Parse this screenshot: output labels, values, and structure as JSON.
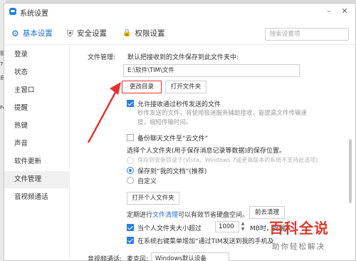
{
  "window": {
    "title": "系统设置",
    "controls": {
      "minimize_icon": "–",
      "close_icon": "✕"
    }
  },
  "navbar": {
    "tabs": [
      {
        "label": "基本设置",
        "icon": "gear-icon",
        "glyph": "⚙"
      },
      {
        "label": "安全设置",
        "icon": "shield-icon",
        "glyph": "⛨"
      },
      {
        "label": "权限设置",
        "icon": "lock-icon",
        "glyph": "🔒"
      }
    ],
    "search_placeholder": "搜索设置项"
  },
  "sidebar": {
    "items": [
      {
        "label": "登录"
      },
      {
        "label": "状态"
      },
      {
        "label": "主窗口"
      },
      {
        "label": "提醒"
      },
      {
        "label": "热键"
      },
      {
        "label": "声音"
      },
      {
        "label": "软件更新"
      },
      {
        "label": "文件管理",
        "active": true
      },
      {
        "label": "音视频通话"
      }
    ]
  },
  "file_mgmt": {
    "section_label": "文件管理:",
    "default_folder_text": "默认把接收到的文件保存到此文件夹中:",
    "path_value": "E:\\软件\\TIM\\文件",
    "change_dir_button": "更改目录",
    "open_folder_button": "打开文件夹",
    "allow_second_transfer": {
      "label": "允许接收通过秒传发送的文件",
      "checked": true,
      "desc_line1": "秒传发送的文件，将使用极速服务辅助接收，能提高文件传输速",
      "desc_line2": "度，缩短传输时间。"
    },
    "backup_chat_files": {
      "label": "备份聊天文件至“云文件”",
      "checked": false
    },
    "personal_folder_title": "选择个人文件夹(用于保存消息记录等数据)的保存位置。",
    "radio_options": [
      {
        "label": "保存到安装目录下(Vista、Windows 7或更高版本的系统不支持此选项)",
        "selected": false,
        "disabled": true
      },
      {
        "label": "保存到“我的文档”(推荐)",
        "selected": true,
        "disabled": false
      },
      {
        "label": "自定义",
        "selected": false,
        "disabled": false
      }
    ],
    "open_personal_folder_button": "打开个人文件夹",
    "cleanup_text_prefix": "定期进行",
    "cleanup_link": "文件清理",
    "cleanup_text_suffix": "可以有效节省硬盘空间。",
    "cleanup_button": "前去清理",
    "size_limit": {
      "label_prefix": "当个人文件夹大小超过",
      "value": "1000",
      "label_suffix": "MB时，提醒",
      "checked": true
    },
    "context_menu": {
      "label": "在系统右键菜单增加“通过TIM发送到我的手机及",
      "checked": true
    },
    "cut_row_label": "音视频通话:",
    "cut_row_sub": "麦克风:",
    "cut_row_select": "Windows默认设备"
  },
  "watermark": {
    "title": "百科全说",
    "subtitle": "助你轻松解决"
  },
  "colors": {
    "accent": "#1f6fd1",
    "highlight_red": "#e23434",
    "checkbox_blue": "#2b7de0"
  }
}
